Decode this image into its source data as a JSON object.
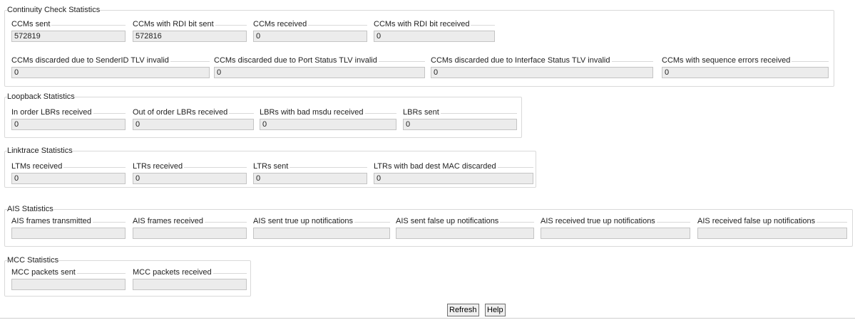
{
  "continuity": {
    "title": "Continuity Check Statistics",
    "fields": [
      {
        "label": "CCMs sent",
        "value": "572819"
      },
      {
        "label": "CCMs with RDI bit sent",
        "value": "572816"
      },
      {
        "label": "CCMs received",
        "value": "0"
      },
      {
        "label": "CCMs with RDI bit received",
        "value": "0"
      },
      {
        "label": "CCMs discarded due to SenderID TLV invalid",
        "value": "0"
      },
      {
        "label": "CCMs discarded due to Port Status TLV invalid",
        "value": "0"
      },
      {
        "label": "CCMs discarded due to Interface Status TLV invalid",
        "value": "0"
      },
      {
        "label": "CCMs with sequence errors received",
        "value": "0"
      }
    ]
  },
  "loopback": {
    "title": "Loopback Statistics",
    "fields": [
      {
        "label": "In order LBRs received",
        "value": "0"
      },
      {
        "label": "Out of order LBRs received",
        "value": "0"
      },
      {
        "label": "LBRs with bad msdu received",
        "value": "0"
      },
      {
        "label": "LBRs sent",
        "value": "0"
      }
    ]
  },
  "linktrace": {
    "title": "Linktrace Statistics",
    "fields": [
      {
        "label": "LTMs received",
        "value": "0"
      },
      {
        "label": "LTRs received",
        "value": "0"
      },
      {
        "label": "LTRs sent",
        "value": "0"
      },
      {
        "label": "LTRs with bad dest MAC discarded",
        "value": "0"
      }
    ]
  },
  "ais": {
    "title": "AIS Statistics",
    "fields": [
      {
        "label": "AIS frames transmitted",
        "value": ""
      },
      {
        "label": "AIS frames received",
        "value": ""
      },
      {
        "label": "AIS sent true up notifications",
        "value": ""
      },
      {
        "label": "AIS sent false up notifications",
        "value": ""
      },
      {
        "label": "AIS received true up notifications",
        "value": ""
      },
      {
        "label": "AIS received false up notifications",
        "value": ""
      }
    ]
  },
  "mcc": {
    "title": "MCC Statistics",
    "fields": [
      {
        "label": "MCC packets sent",
        "value": ""
      },
      {
        "label": "MCC packets received",
        "value": ""
      }
    ]
  },
  "buttons": {
    "refresh": "Refresh",
    "help": "Help"
  }
}
